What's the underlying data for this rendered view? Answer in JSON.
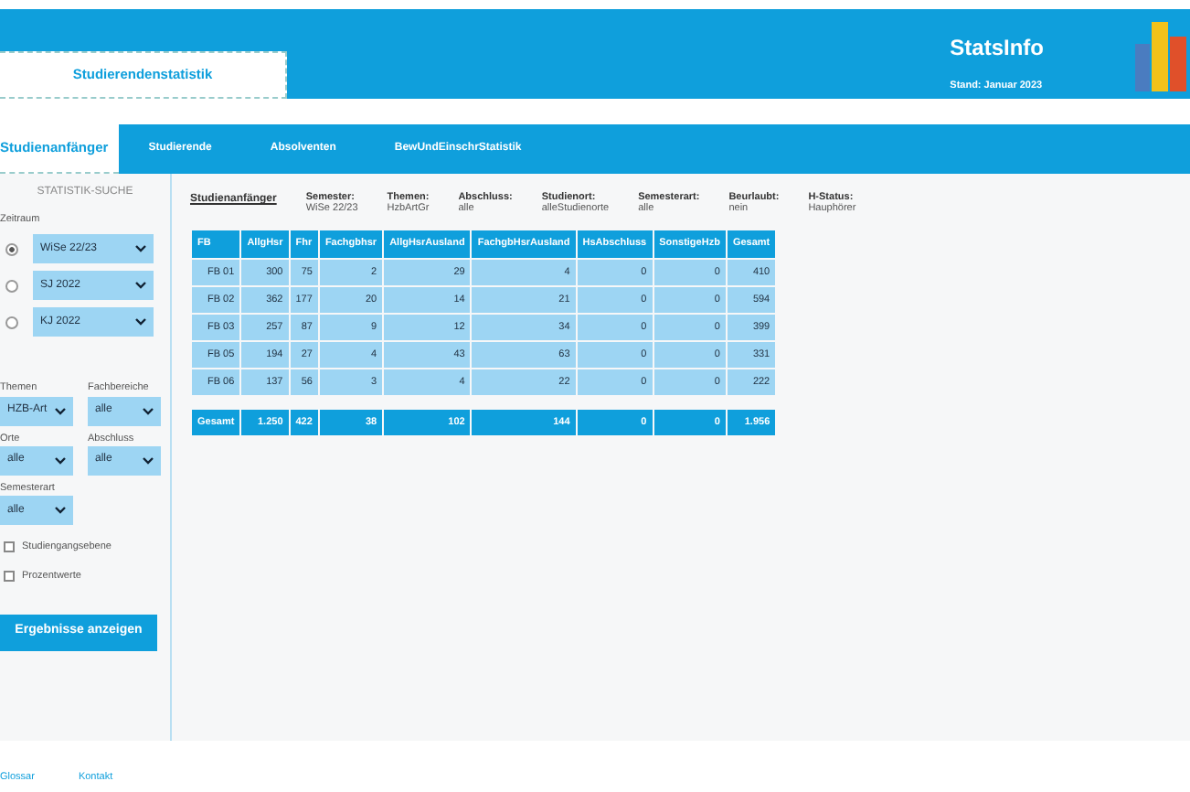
{
  "header": {
    "section_tab": "Studierendenstatistik",
    "title": "StatsInfo",
    "date": "Stand: Januar 2023"
  },
  "nav": [
    {
      "label": "Studienanfänger",
      "selected": true
    },
    {
      "label": "Studierende",
      "selected": false
    },
    {
      "label": "Absolventen",
      "selected": false
    },
    {
      "label": "BewUndEinschrStatistik",
      "selected": false
    }
  ],
  "sidebar": {
    "heading": "STATISTIK-SUCHE",
    "period_label": "Zeitraum",
    "periods": [
      {
        "value": "WiSe 22/23",
        "selected": true
      },
      {
        "value": "SJ 2022",
        "selected": false
      },
      {
        "value": "KJ 2022",
        "selected": false
      }
    ],
    "filters": [
      {
        "label": "Themen",
        "value": "HZB-Art"
      },
      {
        "label": "Fachbereiche",
        "value": "alle"
      },
      {
        "label": "Orte",
        "value": "alle"
      },
      {
        "label": "Abschluss",
        "value": "alle"
      },
      {
        "label": "Semesterart",
        "value": "alle"
      }
    ],
    "checkboxes": [
      {
        "label": "Studiengangsebene",
        "checked": false
      },
      {
        "label": "Prozentwerte",
        "checked": false
      }
    ],
    "button": "Ergebnisse anzeigen"
  },
  "summary": {
    "title": "Studienanfänger",
    "items": [
      {
        "label": "Semester:",
        "value": "WiSe 22/23"
      },
      {
        "label": "Themen:",
        "value": "HzbArtGr"
      },
      {
        "label": "Abschluss:",
        "value": "alle"
      },
      {
        "label": "Studienort:",
        "value": "alleStudienorte"
      },
      {
        "label": "Semesterart:",
        "value": "alle"
      },
      {
        "label": "Beurlaubt:",
        "value": "nein"
      },
      {
        "label": "H-Status:",
        "value": "Hauphörer"
      }
    ]
  },
  "table": {
    "columns": [
      "FB",
      "AllgHsr",
      "Fhr",
      "Fachgbhsr",
      "AllgHsrAusland",
      "FachgbHsrAusland",
      "HsAbschluss",
      "SonstigeHzb",
      "Gesamt"
    ],
    "rows": [
      [
        "FB 01",
        "300",
        "75",
        "2",
        "29",
        "4",
        "0",
        "0",
        "410"
      ],
      [
        "FB 02",
        "362",
        "177",
        "20",
        "14",
        "21",
        "0",
        "0",
        "594"
      ],
      [
        "FB 03",
        "257",
        "87",
        "9",
        "12",
        "34",
        "0",
        "0",
        "399"
      ],
      [
        "FB 05",
        "194",
        "27",
        "4",
        "43",
        "63",
        "0",
        "0",
        "331"
      ],
      [
        "FB 06",
        "137",
        "56",
        "3",
        "4",
        "22",
        "0",
        "0",
        "222"
      ]
    ],
    "total": [
      "Gesamt",
      "1.250",
      "422",
      "38",
      "102",
      "144",
      "0",
      "0",
      "1.956"
    ]
  },
  "footer": [
    "Glossar",
    "Kontakt"
  ]
}
